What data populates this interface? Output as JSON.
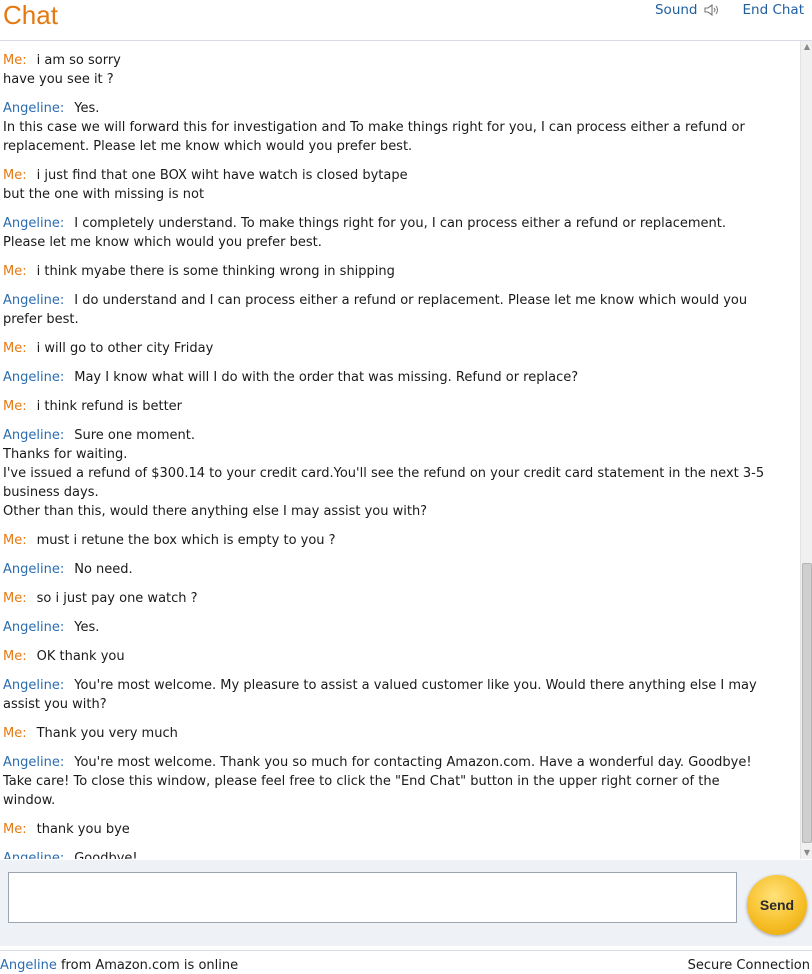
{
  "header": {
    "title": "Chat",
    "sound_label": "Sound",
    "sound_icon": "speaker-icon",
    "end_chat_label": "End Chat"
  },
  "messages": [
    {
      "speaker": "Me:",
      "role": "me",
      "lines": [
        "i am so sorry",
        "have you see it ?"
      ]
    },
    {
      "speaker": "Angeline:",
      "role": "agent",
      "lines": [
        "Yes.",
        "In this case we will forward this for investigation and To make things right for you, I can process either a refund or replacement. Please let me know which would you prefer best."
      ]
    },
    {
      "speaker": "Me:",
      "role": "me",
      "lines": [
        "i just find that one BOX wiht have watch is closed bytape",
        "but the one with missing is not"
      ]
    },
    {
      "speaker": "Angeline:",
      "role": "agent",
      "lines": [
        "I completely understand. To make things right for you, I can process either a refund or replacement. Please let me know which would you prefer best."
      ]
    },
    {
      "speaker": "Me:",
      "role": "me",
      "lines": [
        "i think myabe there is some thinking wrong in shipping"
      ]
    },
    {
      "speaker": "Angeline:",
      "role": "agent",
      "lines": [
        "I do understand and I can process either a refund or replacement. Please let me know which would you prefer best."
      ]
    },
    {
      "speaker": "Me:",
      "role": "me",
      "lines": [
        "i will go to other city Friday"
      ]
    },
    {
      "speaker": "Angeline:",
      "role": "agent",
      "lines": [
        "May I know what will I do with the order that was missing. Refund or replace?"
      ]
    },
    {
      "speaker": "Me:",
      "role": "me",
      "lines": [
        "i think refund is better"
      ]
    },
    {
      "speaker": "Angeline:",
      "role": "agent",
      "lines": [
        "Sure one moment.",
        "Thanks for waiting.",
        "I've issued a refund of $300.14 to your credit card.You'll see the refund on your credit card statement in the next 3-5 business days.",
        "Other than this, would there anything else I may assist you with?"
      ]
    },
    {
      "speaker": "Me:",
      "role": "me",
      "lines": [
        "must i retune the box which is empty to you ?"
      ]
    },
    {
      "speaker": "Angeline:",
      "role": "agent",
      "lines": [
        "No need."
      ]
    },
    {
      "speaker": "Me:",
      "role": "me",
      "lines": [
        "so i just pay one watch ?"
      ]
    },
    {
      "speaker": "Angeline:",
      "role": "agent",
      "lines": [
        "Yes."
      ]
    },
    {
      "speaker": "Me:",
      "role": "me",
      "lines": [
        "OK thank you"
      ]
    },
    {
      "speaker": "Angeline:",
      "role": "agent",
      "lines": [
        "You're most welcome. My pleasure to assist a valued customer like you. Would there anything else I may assist you with?"
      ]
    },
    {
      "speaker": "Me:",
      "role": "me",
      "lines": [
        "Thank you very much"
      ]
    },
    {
      "speaker": "Angeline:",
      "role": "agent",
      "lines": [
        "You're most welcome. Thank you so much for contacting Amazon.com. Have a wonderful day. Goodbye! Take care! To close this window, please feel free to click the \"End Chat\" button in the upper right corner of the window."
      ]
    },
    {
      "speaker": "Me:",
      "role": "me",
      "lines": [
        "thank you bye"
      ]
    },
    {
      "speaker": "Angeline:",
      "role": "agent",
      "lines": [
        "Goodbye!"
      ]
    }
  ],
  "composer": {
    "placeholder": "",
    "send_label": "Send"
  },
  "footer": {
    "agent_name": "Angeline",
    "status_suffix": " from Amazon.com is online",
    "secure_label": "Secure Connection"
  },
  "colors": {
    "accent_orange": "#e47911",
    "agent_blue": "#2b6cb0",
    "link_blue": "#1f5fa0"
  }
}
